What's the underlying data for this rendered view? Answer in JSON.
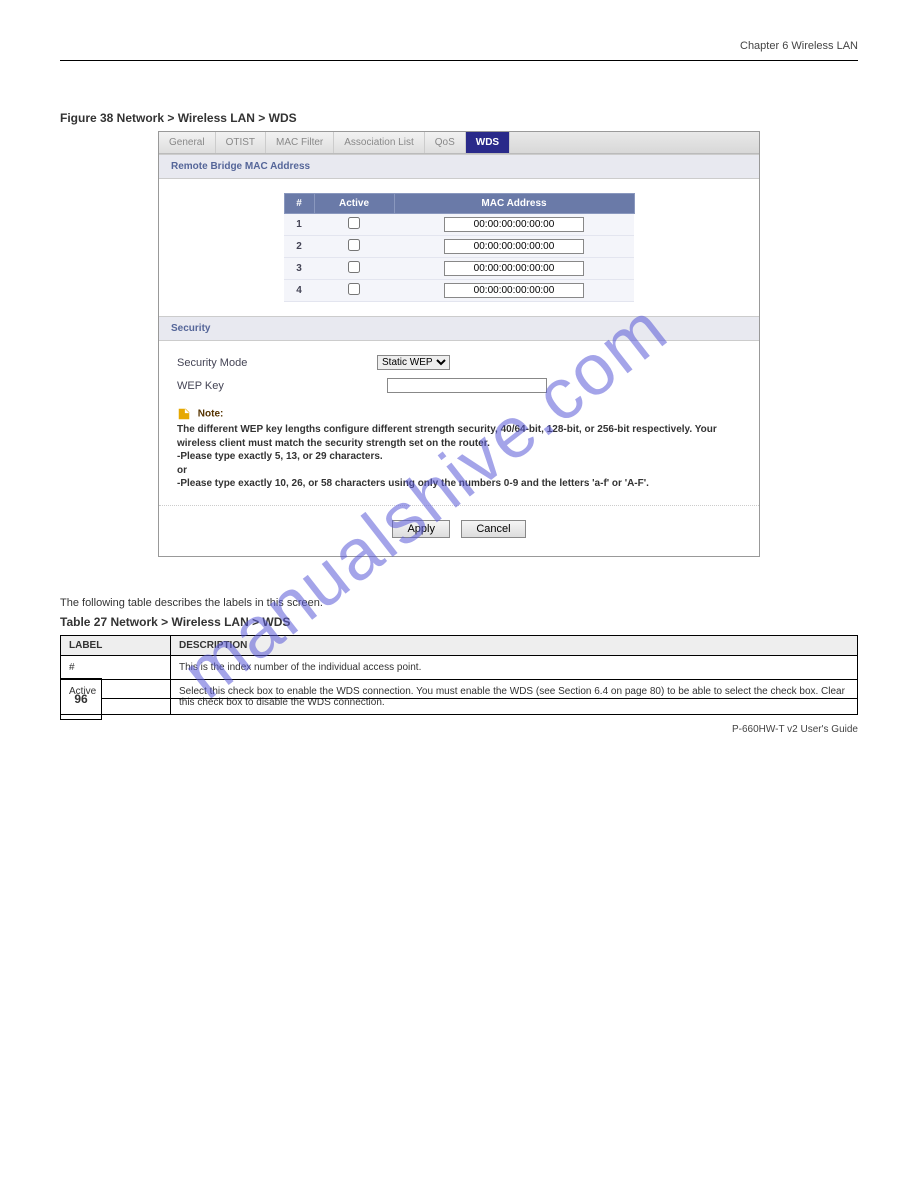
{
  "page_header": "Chapter 6 Wireless LAN",
  "figure_label": "Figure 38   Network > Wireless LAN > WDS",
  "tabs": [
    "General",
    "OTIST",
    "MAC Filter",
    "Association List",
    "QoS",
    "WDS"
  ],
  "active_tab": "WDS",
  "section1_title": "Remote Bridge MAC Address",
  "mac_headers": {
    "num": "#",
    "active": "Active",
    "mac": "MAC Address"
  },
  "mac_rows": [
    {
      "n": "1",
      "mac": "00:00:00:00:00:00"
    },
    {
      "n": "2",
      "mac": "00:00:00:00:00:00"
    },
    {
      "n": "3",
      "mac": "00:00:00:00:00:00"
    },
    {
      "n": "4",
      "mac": "00:00:00:00:00:00"
    }
  ],
  "section2_title": "Security",
  "security_mode_label": "Security Mode",
  "security_mode_value": "Static WEP",
  "wep_key_label": "WEP Key",
  "note_title": "Note:",
  "note_lines": [
    "The different WEP key lengths configure different strength security, 40/64-bit, 128-bit, or 256-bit respectively. Your wireless client must match the security strength set on the router.",
    "-Please type exactly 5, 13, or 29 characters.",
    "or",
    "-Please type exactly 10, 26, or 58 characters using only the numbers 0-9 and the letters 'a-f' or 'A-F'."
  ],
  "apply_label": "Apply",
  "cancel_label": "Cancel",
  "watermark": "manualshive.com",
  "desc_text": "The following table describes the labels in this screen.",
  "table_label": "Table 27   Network > Wireless LAN > WDS",
  "info_headers": {
    "label": "LABEL",
    "desc": "DESCRIPTION"
  },
  "info_rows": [
    {
      "label": "#",
      "desc": "This is the index number of the individual access point."
    },
    {
      "label": "Active",
      "desc": "Select this check box to enable the WDS connection. You must enable the WDS (see Section 6.4 on page 80) to be able to select the check box. Clear this check box to disable the WDS connection."
    }
  ],
  "page_number": "96",
  "footer_text": "P-660HW-T v2 User's Guide"
}
